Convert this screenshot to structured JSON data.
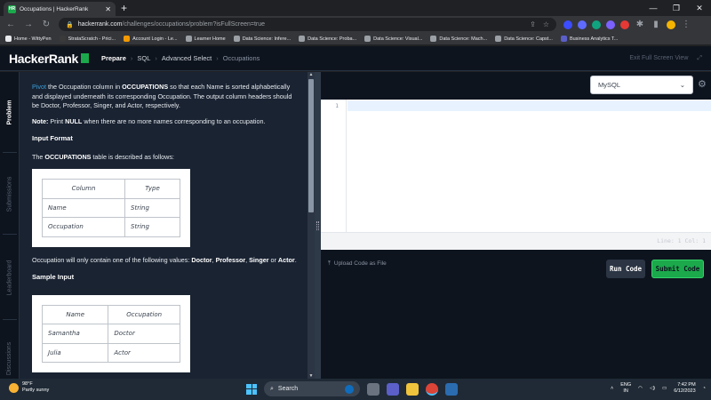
{
  "browser": {
    "tab_title": "Occupations | HackerRank",
    "tab_favicon_text": "HR",
    "url_host": "hackerrank.com",
    "url_path": "/challenges/occupations/problem?isFullScreen=true",
    "bookmarks": [
      "Home - WittyPen",
      "StrataScratch - Prici...",
      "Account Login - Le...",
      "Learner Home",
      "Data Science: Infere...",
      "Data Science: Proba...",
      "Data Science: Visual...",
      "Data Science: Mach...",
      "Data Science: Capst...",
      "Business Analytics T..."
    ]
  },
  "header": {
    "logo": "HackerRank",
    "crumbs": [
      "Prepare",
      "SQL",
      "Advanced Select",
      "Occupations"
    ],
    "exit_fullscreen": "Exit Full Screen View"
  },
  "sidetabs": [
    "Problem",
    "Submissions",
    "Leaderboard",
    "Discussions"
  ],
  "problem": {
    "intro_link": "Pivot",
    "intro_1": " the Occupation column in ",
    "intro_table": "OCCUPATIONS",
    "intro_2": " so that each Name is sorted alphabetically and displayed underneath its corresponding Occupation. The output column headers should be Doctor, Professor, Singer, and Actor, respectively.",
    "note_label": "Note:",
    "note_1": " Print ",
    "note_null": "NULL",
    "note_2": " when there are no more names corresponding to an occupation.",
    "input_format": "Input Format",
    "desc_1": "The ",
    "desc_table": "OCCUPATIONS",
    "desc_2": " table is described as follows:",
    "schema_headers": [
      "Column",
      "Type"
    ],
    "schema_rows": [
      [
        "Name",
        "String"
      ],
      [
        "Occupation",
        "String"
      ]
    ],
    "values_1": "Occupation will only contain one of the following values: ",
    "values_list": [
      "Doctor",
      "Professor",
      "Singer"
    ],
    "values_or": " or ",
    "values_last": "Actor",
    "sample_input": "Sample Input",
    "sample_headers": [
      "Name",
      "Occupation"
    ],
    "sample_rows": [
      [
        "Samantha",
        "Doctor"
      ],
      [
        "Julia",
        "Actor"
      ]
    ]
  },
  "editor": {
    "language": "MySQL",
    "line_number": "1",
    "status": "Line: 1 Col: 1",
    "upload_label": "Upload Code as File",
    "run_label": "Run Code",
    "submit_label": "Submit Code"
  },
  "taskbar": {
    "temp": "98°F",
    "weather": "Partly sunny",
    "search": "Search",
    "lang_top": "ENG",
    "lang_bottom": "IN",
    "time": "7:42 PM",
    "date": "6/12/2023"
  }
}
